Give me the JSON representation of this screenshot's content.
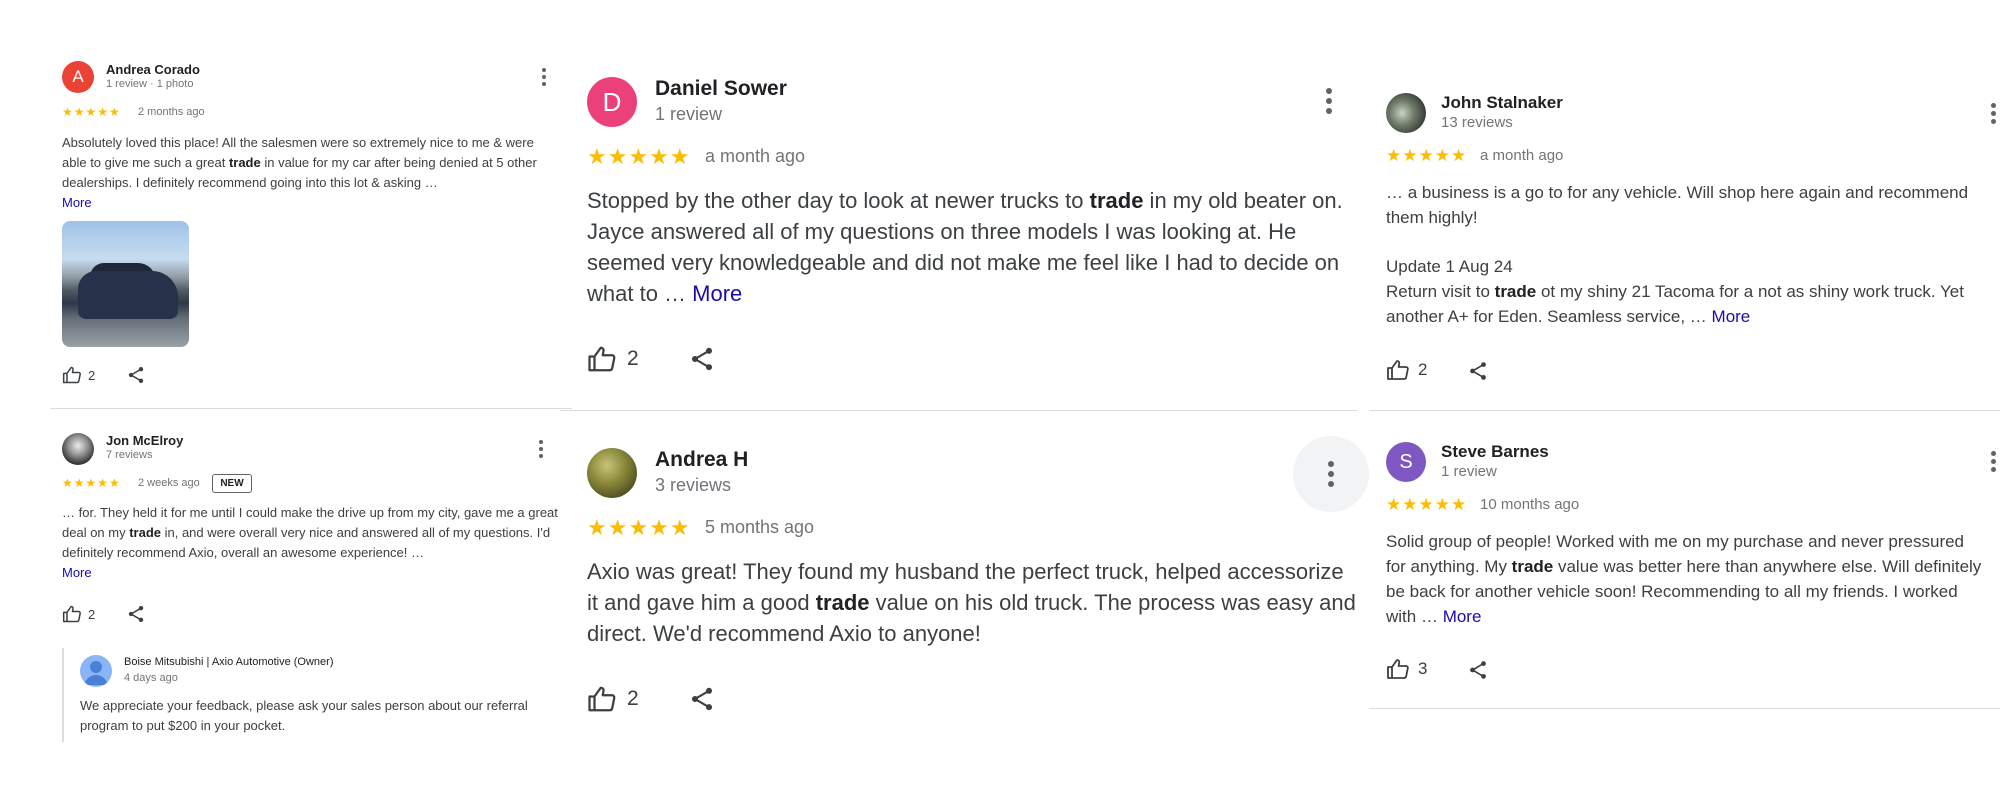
{
  "colors": {
    "star": "#fbbc04",
    "link": "#1a0dab",
    "meta": "#70757a",
    "divider": "#dadce0"
  },
  "reviews": {
    "andrea_corado": {
      "initial": "A",
      "avatar_color": "#ea4335",
      "name": "Andrea Corado",
      "meta": "1 review · 1 photo",
      "stars": "★★★★★",
      "ago": "2 months ago",
      "text_before": "Absolutely loved this place! All the salesmen were so extremely nice to me & were able to give me such a great ",
      "keyword": "trade",
      "text_after": " in value for my car after being denied at 5 other dealerships. I definitely recommend going into this lot & asking …",
      "more": "More",
      "photo_icon": "car-photo",
      "likes": "2"
    },
    "jon_mcelroy": {
      "name": "Jon McElroy",
      "meta": "7 reviews",
      "stars": "★★★★★",
      "ago": "2 weeks ago",
      "badge": "NEW",
      "text_before": "… for. They held it for me until I could make the drive up from my city, gave me a great deal on my ",
      "keyword": "trade",
      "text_after": " in, and were overall very nice and answered all of my questions. I'd definitely recommend Axio, overall an awesome experience! …",
      "more": "More",
      "likes": "2",
      "owner": {
        "name": "Boise Mitsubishi | Axio Automotive (Owner)",
        "ago": "4 days ago",
        "text": "We appreciate your feedback, please ask your sales person about our referral program to put $200 in your pocket."
      }
    },
    "daniel_sower": {
      "initial": "D",
      "avatar_color": "#ec407a",
      "name": "Daniel Sower",
      "meta": "1 review",
      "stars": "★★★★★",
      "ago": "a month ago",
      "text_before": "Stopped by the other day to look at newer trucks to ",
      "keyword": "trade",
      "text_after": " in my old beater on. Jayce answered all of my questions on three models I was looking at. He seemed very knowledgeable and did not make me feel like I had to decide on what to … ",
      "more": "More",
      "likes": "2"
    },
    "andrea_h": {
      "name": "Andrea H",
      "meta": "3 reviews",
      "stars": "★★★★★",
      "ago": "5 months ago",
      "text_before": "Axio was great! They found my husband the perfect truck, helped accessorize it and gave him a good ",
      "keyword": "trade",
      "text_after": " value on his old truck. The process was easy and direct. We'd recommend Axio to anyone!",
      "likes": "2"
    },
    "john_stalnaker": {
      "name": "John Stalnaker",
      "meta": "13 reviews",
      "stars": "★★★★★",
      "ago": "a month ago",
      "text_1": "… a business is a go to for any vehicle. Will shop here again and recommend them highly!",
      "update_label": "Update 1 Aug 24",
      "text_before": "Return visit to ",
      "keyword": "trade",
      "text_after": " ot my shiny 21 Tacoma for a not as shiny work truck. Yet another A+ for Eden. Seamless service, … ",
      "more": "More",
      "likes": "2"
    },
    "steve_barnes": {
      "initial": "S",
      "avatar_color": "#7e57c2",
      "name": "Steve Barnes",
      "meta": "1 review",
      "stars": "★★★★★",
      "ago": "10 months ago",
      "text_before": "Solid group of people! Worked with me on my purchase and never pressured for anything. My ",
      "keyword": "trade",
      "text_after": " value was better here than anywhere else. Will definitely be back for another vehicle soon! Recommending to all my friends. I worked with … ",
      "more": "More",
      "likes": "3"
    }
  }
}
